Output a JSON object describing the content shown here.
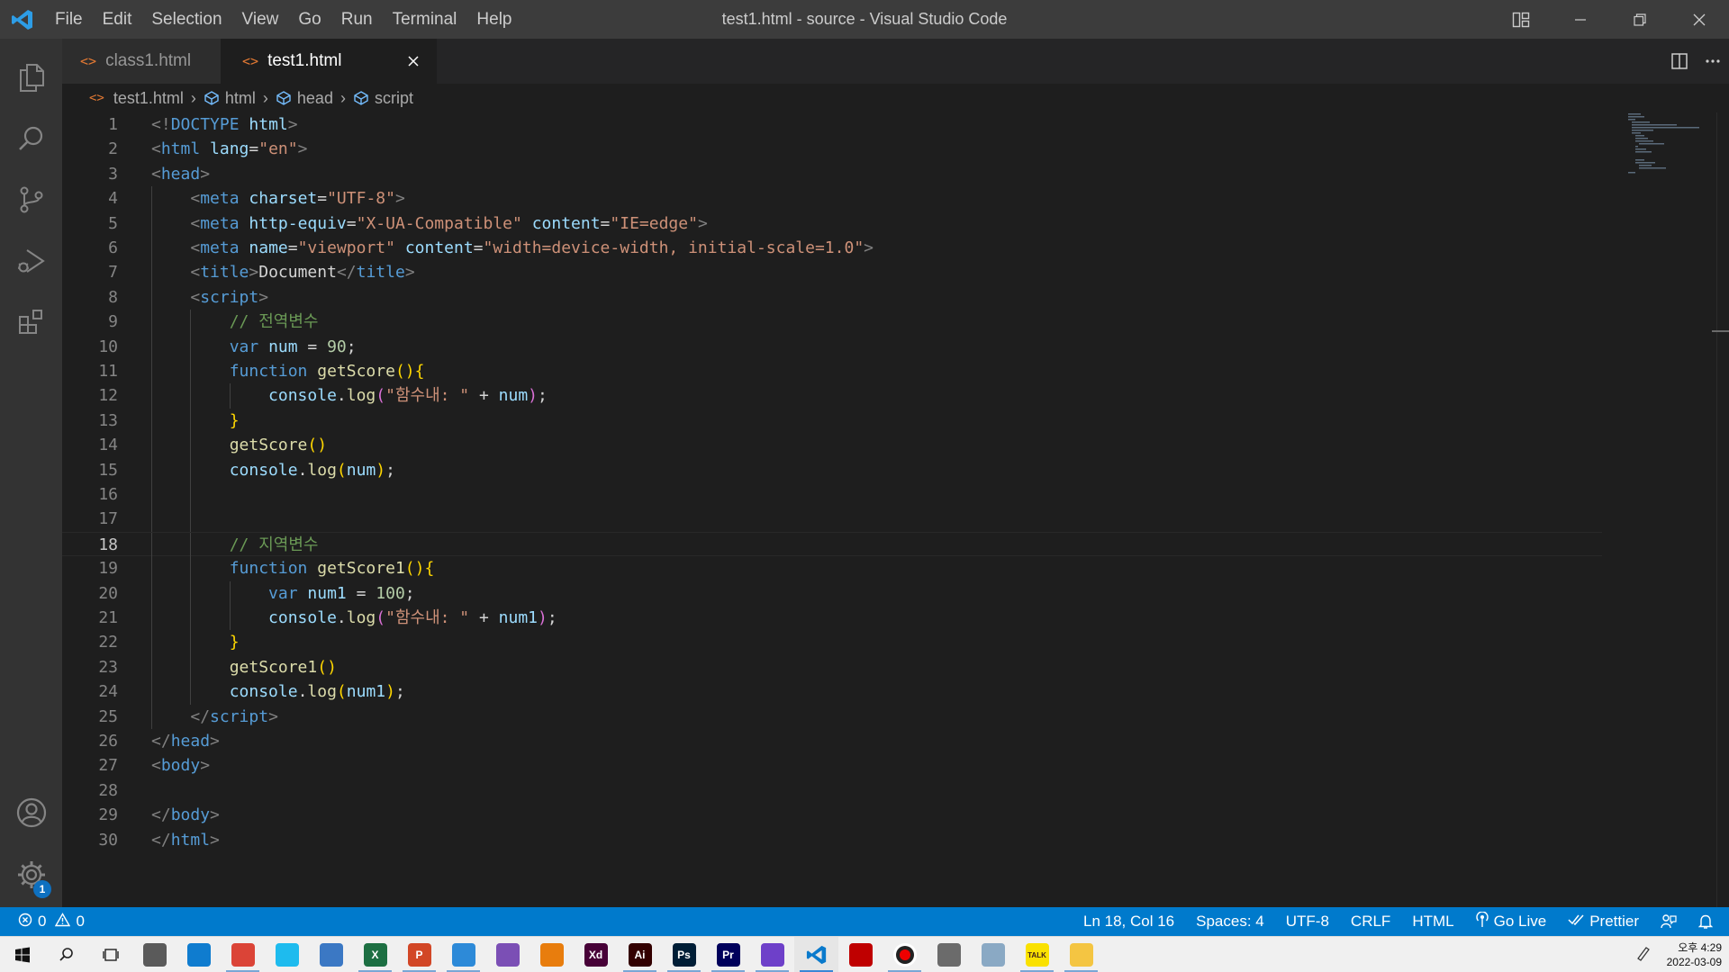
{
  "window": {
    "title": "test1.html - source - Visual Studio Code",
    "logo_icon": "vscode-logo-icon",
    "controls": [
      "layout-icon",
      "minimize-icon",
      "restore-icon",
      "close-icon"
    ]
  },
  "menu": [
    "File",
    "Edit",
    "Selection",
    "View",
    "Go",
    "Run",
    "Terminal",
    "Help"
  ],
  "activity_bar": {
    "top": [
      "explorer-icon",
      "search-icon",
      "source-control-icon",
      "run-debug-icon",
      "extensions-icon"
    ],
    "bottom": [
      "accounts-icon",
      "manage-gear-icon"
    ],
    "manage_badge": "1"
  },
  "tabs": [
    {
      "label": "class1.html",
      "active": false
    },
    {
      "label": "test1.html",
      "active": true
    }
  ],
  "breadcrumb": [
    "test1.html",
    "html",
    "head",
    "script"
  ],
  "editor": {
    "current_line": 18,
    "lines": [
      {
        "n": "1"
      },
      {
        "n": "2"
      },
      {
        "n": "3"
      },
      {
        "n": "4"
      },
      {
        "n": "5"
      },
      {
        "n": "6"
      },
      {
        "n": "7"
      },
      {
        "n": "8"
      },
      {
        "n": "9"
      },
      {
        "n": "10"
      },
      {
        "n": "11"
      },
      {
        "n": "12"
      },
      {
        "n": "13"
      },
      {
        "n": "14"
      },
      {
        "n": "15"
      },
      {
        "n": "16"
      },
      {
        "n": "17"
      },
      {
        "n": "18"
      },
      {
        "n": "19"
      },
      {
        "n": "20"
      },
      {
        "n": "21"
      },
      {
        "n": "22"
      },
      {
        "n": "23"
      },
      {
        "n": "24"
      },
      {
        "n": "25"
      },
      {
        "n": "26"
      },
      {
        "n": "27"
      },
      {
        "n": "28"
      },
      {
        "n": "29"
      },
      {
        "n": "30"
      }
    ],
    "code": [
      [
        [
          "punc",
          "<!"
        ],
        [
          "tag",
          "DOCTYPE "
        ],
        [
          "attr",
          "html"
        ],
        [
          "punc",
          ">"
        ]
      ],
      [
        [
          "punc",
          "<"
        ],
        [
          "tag",
          "html "
        ],
        [
          "attr",
          "lang"
        ],
        [
          "text",
          "="
        ],
        [
          "str",
          "\"en\""
        ],
        [
          "punc",
          ">"
        ]
      ],
      [
        [
          "punc",
          "<"
        ],
        [
          "tag",
          "head"
        ],
        [
          "punc",
          ">"
        ]
      ],
      [
        [
          "text",
          "    "
        ],
        [
          "punc",
          "<"
        ],
        [
          "tag",
          "meta "
        ],
        [
          "attr",
          "charset"
        ],
        [
          "text",
          "="
        ],
        [
          "str",
          "\"UTF-8\""
        ],
        [
          "punc",
          ">"
        ]
      ],
      [
        [
          "text",
          "    "
        ],
        [
          "punc",
          "<"
        ],
        [
          "tag",
          "meta "
        ],
        [
          "attr",
          "http-equiv"
        ],
        [
          "text",
          "="
        ],
        [
          "str",
          "\"X-UA-Compatible\""
        ],
        [
          "text",
          " "
        ],
        [
          "attr",
          "content"
        ],
        [
          "text",
          "="
        ],
        [
          "str",
          "\"IE=edge\""
        ],
        [
          "punc",
          ">"
        ]
      ],
      [
        [
          "text",
          "    "
        ],
        [
          "punc",
          "<"
        ],
        [
          "tag",
          "meta "
        ],
        [
          "attr",
          "name"
        ],
        [
          "text",
          "="
        ],
        [
          "str",
          "\"viewport\""
        ],
        [
          "text",
          " "
        ],
        [
          "attr",
          "content"
        ],
        [
          "text",
          "="
        ],
        [
          "str",
          "\"width=device-width, initial-scale=1.0\""
        ],
        [
          "punc",
          ">"
        ]
      ],
      [
        [
          "text",
          "    "
        ],
        [
          "punc",
          "<"
        ],
        [
          "tag",
          "title"
        ],
        [
          "punc",
          ">"
        ],
        [
          "text",
          "Document"
        ],
        [
          "punc",
          "</"
        ],
        [
          "tag",
          "title"
        ],
        [
          "punc",
          ">"
        ]
      ],
      [
        [
          "text",
          "    "
        ],
        [
          "punc",
          "<"
        ],
        [
          "tag",
          "script"
        ],
        [
          "punc",
          ">"
        ]
      ],
      [
        [
          "text",
          "        "
        ],
        [
          "com",
          "// 전역변수"
        ]
      ],
      [
        [
          "text",
          "        "
        ],
        [
          "kw",
          "var "
        ],
        [
          "var",
          "num"
        ],
        [
          "op",
          " = "
        ],
        [
          "num",
          "90"
        ],
        [
          "op",
          ";"
        ]
      ],
      [
        [
          "text",
          "        "
        ],
        [
          "kw",
          "function "
        ],
        [
          "fn",
          "getScore"
        ],
        [
          "b1",
          "()"
        ],
        [
          "b1",
          "{"
        ]
      ],
      [
        [
          "text",
          "            "
        ],
        [
          "var",
          "console"
        ],
        [
          "op",
          "."
        ],
        [
          "fn",
          "log"
        ],
        [
          "b2",
          "("
        ],
        [
          "str",
          "\"함수내: \""
        ],
        [
          "op",
          " + "
        ],
        [
          "var",
          "num"
        ],
        [
          "b2",
          ")"
        ],
        [
          "op",
          ";"
        ]
      ],
      [
        [
          "text",
          "        "
        ],
        [
          "b1",
          "}"
        ]
      ],
      [
        [
          "text",
          "        "
        ],
        [
          "fn",
          "getScore"
        ],
        [
          "b1",
          "()"
        ]
      ],
      [
        [
          "text",
          "        "
        ],
        [
          "var",
          "console"
        ],
        [
          "op",
          "."
        ],
        [
          "fn",
          "log"
        ],
        [
          "b1",
          "("
        ],
        [
          "var",
          "num"
        ],
        [
          "b1",
          ")"
        ],
        [
          "op",
          ";"
        ]
      ],
      [],
      [],
      [
        [
          "text",
          "        "
        ],
        [
          "com",
          "// 지역변수"
        ]
      ],
      [
        [
          "text",
          "        "
        ],
        [
          "kw",
          "function "
        ],
        [
          "fn",
          "getScore1"
        ],
        [
          "b1",
          "()"
        ],
        [
          "b1",
          "{"
        ]
      ],
      [
        [
          "text",
          "            "
        ],
        [
          "kw",
          "var "
        ],
        [
          "var",
          "num1"
        ],
        [
          "op",
          " = "
        ],
        [
          "num",
          "100"
        ],
        [
          "op",
          ";"
        ]
      ],
      [
        [
          "text",
          "            "
        ],
        [
          "var",
          "console"
        ],
        [
          "op",
          "."
        ],
        [
          "fn",
          "log"
        ],
        [
          "b2",
          "("
        ],
        [
          "str",
          "\"함수내: \""
        ],
        [
          "op",
          " + "
        ],
        [
          "var",
          "num1"
        ],
        [
          "b2",
          ")"
        ],
        [
          "op",
          ";"
        ]
      ],
      [
        [
          "text",
          "        "
        ],
        [
          "b1",
          "}"
        ]
      ],
      [
        [
          "text",
          "        "
        ],
        [
          "fn",
          "getScore1"
        ],
        [
          "b1",
          "()"
        ]
      ],
      [
        [
          "text",
          "        "
        ],
        [
          "var",
          "console"
        ],
        [
          "op",
          "."
        ],
        [
          "fn",
          "log"
        ],
        [
          "b1",
          "("
        ],
        [
          "var",
          "num1"
        ],
        [
          "b1",
          ")"
        ],
        [
          "op",
          ";"
        ]
      ],
      [
        [
          "text",
          "    "
        ],
        [
          "punc",
          "</"
        ],
        [
          "tag",
          "script"
        ],
        [
          "punc",
          ">"
        ]
      ],
      [
        [
          "punc",
          "</"
        ],
        [
          "tag",
          "head"
        ],
        [
          "punc",
          ">"
        ]
      ],
      [
        [
          "punc",
          "<"
        ],
        [
          "tag",
          "body"
        ],
        [
          "punc",
          ">"
        ]
      ],
      [],
      [
        [
          "punc",
          "</"
        ],
        [
          "tag",
          "body"
        ],
        [
          "punc",
          ">"
        ]
      ],
      [
        [
          "punc",
          "</"
        ],
        [
          "tag",
          "html"
        ],
        [
          "punc",
          ">"
        ]
      ]
    ]
  },
  "status": {
    "errors": "0",
    "warnings": "0",
    "position": "Ln 18, Col 16",
    "spaces": "Spaces: 4",
    "encoding": "UTF-8",
    "eol": "CRLF",
    "language": "HTML",
    "go_live": "Go Live",
    "prettier": "Prettier"
  },
  "taskbar": {
    "apps": [
      {
        "name": "windows-start-icon",
        "label": "",
        "color": "#0078d7"
      },
      {
        "name": "search-icon",
        "label": "",
        "color": "#333333"
      },
      {
        "name": "task-view-icon",
        "label": "",
        "color": "#333333"
      },
      {
        "name": "keyboard-app-icon",
        "label": "",
        "color": "#5a5a5a"
      },
      {
        "name": "edge-icon",
        "label": "",
        "color": "#0f7ccf"
      },
      {
        "name": "chrome-icon",
        "label": "",
        "color": "#db4437"
      },
      {
        "name": "internet-explorer-icon",
        "label": "",
        "color": "#1ebbee"
      },
      {
        "name": "control-panel-icon",
        "label": "",
        "color": "#3b78c4"
      },
      {
        "name": "excel-icon",
        "label": "X",
        "color": "#1d6f42"
      },
      {
        "name": "powerpoint-icon",
        "label": "P",
        "color": "#d24726"
      },
      {
        "name": "windows-tile-icon",
        "label": "",
        "color": "#2d8ad8"
      },
      {
        "name": "paint-app-icon",
        "label": "",
        "color": "#7b4fb5"
      },
      {
        "name": "blender-icon",
        "label": "",
        "color": "#e87d0d"
      },
      {
        "name": "adobe-xd-icon",
        "label": "Xd",
        "color": "#470137"
      },
      {
        "name": "illustrator-icon",
        "label": "Ai",
        "color": "#330000"
      },
      {
        "name": "photoshop-icon",
        "label": "Ps",
        "color": "#001e36"
      },
      {
        "name": "premiere-icon",
        "label": "Pr",
        "color": "#00005b"
      },
      {
        "name": "github-desktop-icon",
        "label": "",
        "color": "#6e40c9"
      },
      {
        "name": "vscode-icon",
        "label": "",
        "color": "#0065a9"
      },
      {
        "name": "filezilla-icon",
        "label": "",
        "color": "#bf0000"
      },
      {
        "name": "record-icon",
        "label": "",
        "color": "#222222"
      },
      {
        "name": "calculator-icon",
        "label": "",
        "color": "#6b6b6b"
      },
      {
        "name": "notepad-icon",
        "label": "",
        "color": "#8aa9c4"
      },
      {
        "name": "kakaotalk-icon",
        "label": "TALK",
        "color": "#fae100"
      },
      {
        "name": "file-explorer-icon",
        "label": "",
        "color": "#f4c542"
      }
    ],
    "time": "오후 4:29",
    "date": "2022-03-09"
  }
}
